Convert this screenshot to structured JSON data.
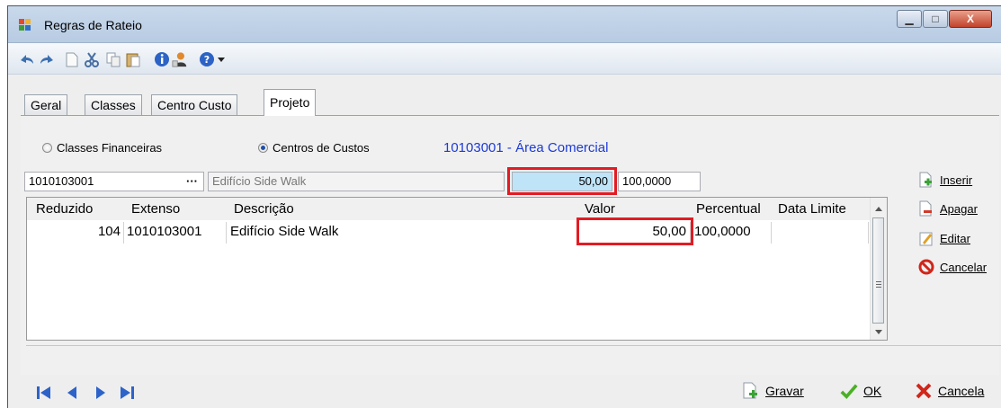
{
  "window": {
    "title": "Regras de Rateio",
    "controls": {
      "minimize": "▁",
      "maximize": "□",
      "close": "X"
    }
  },
  "toolbar": {
    "icons": [
      "undo-icon",
      "redo-icon",
      "new-icon",
      "cut-icon",
      "copy-icon",
      "paste-icon",
      "info-icon",
      "user-icon",
      "help-icon",
      "dropdown-icon"
    ]
  },
  "tabs": [
    {
      "label": "Geral",
      "active": false
    },
    {
      "label": "Classes",
      "active": false
    },
    {
      "label": "Centro Custo",
      "active": false
    },
    {
      "label": "Projeto",
      "active": true
    }
  ],
  "panel": {
    "radio_financeiras": "Classes Financeiras",
    "radio_centros": "Centros de Custos",
    "selected_radio": "Centros de Custos",
    "centro_link": "10103001 - Área Comercial",
    "input_codigo": "1010103001",
    "lookup_label": "···",
    "input_descricao": "Edifício Side Walk",
    "input_valor": "50,00",
    "input_percentual": "100,0000"
  },
  "grid": {
    "columns": [
      "Reduzido",
      "Extenso",
      "Descrição",
      "Valor",
      "Percentual",
      "Data Limite"
    ],
    "rows": [
      {
        "reduzido": "104",
        "extenso": "1010103001",
        "descricao": "Edifício Side Walk",
        "valor": "50,00",
        "percentual": "100,0000",
        "data_limite": ""
      }
    ]
  },
  "side_actions": {
    "inserir": "Inserir",
    "apagar": "Apagar",
    "editar": "Editar",
    "cancelar": "Cancelar"
  },
  "bottom": {
    "gravar": "Gravar",
    "ok": "OK",
    "cancela": "Cancela"
  },
  "colors": {
    "accent_link": "#1c3ad6",
    "highlight": "#e31b23",
    "selected_field": "#bfe3f7"
  }
}
